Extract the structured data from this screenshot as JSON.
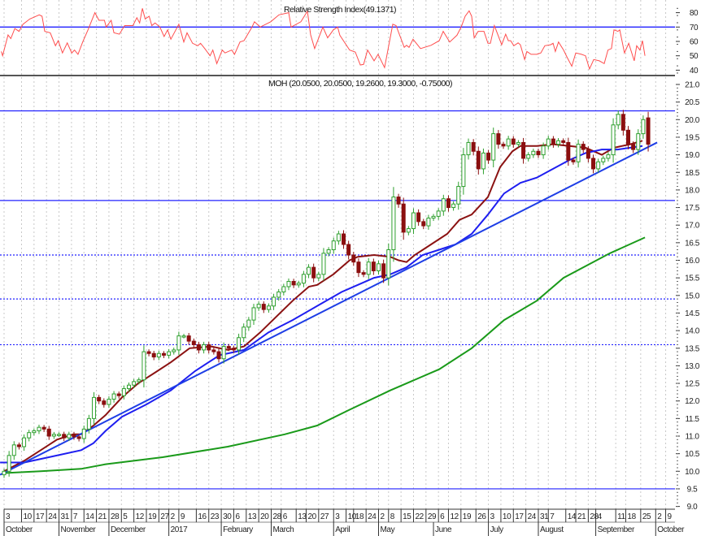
{
  "rsi_panel": {
    "title": "Relative Strength Index(49.1371)",
    "y_ticks": [
      80,
      70,
      60,
      50,
      40
    ],
    "ylim": [
      36,
      90
    ],
    "level": 70
  },
  "price_panel": {
    "title": "MOH (20.0500, 20.0500, 19.2600, 19.3000, -0.75000)",
    "y_ticks": [
      "21.0",
      "20.5",
      "20.0",
      "19.5",
      "19.0",
      "18.5",
      "18.0",
      "17.5",
      "17.0",
      "16.5",
      "16.0",
      "15.5",
      "15.0",
      "14.5",
      "14.0",
      "13.5",
      "13.0",
      "12.5",
      "12.0",
      "11.5",
      "11.0",
      "10.5",
      "10.0",
      "9.5",
      "9.0"
    ],
    "ylim": [
      9.0,
      21.0
    ]
  },
  "colors": {
    "up_candle": "#2ea02e",
    "down_candle": "#8b0f0f",
    "ma_short": "#8b1212",
    "ma_mid": "#1e1ef0",
    "ma_long": "#1a9a1a",
    "trendline": "#1e3ee6",
    "levels": "#2020ff",
    "rsi": "#ff4d4d",
    "grid": "#c8c8c8"
  },
  "chart_data": {
    "type": "candlestick",
    "x_unit": "trading day index (0 = 3 Oct 2016)",
    "bar_step_days": 2,
    "first_open": 9.9,
    "last_open": 20.05,
    "close": [
      10.0,
      10.45,
      10.75,
      10.7,
      10.95,
      11.1,
      11.15,
      11.25,
      11.2,
      11.0,
      11.05,
      11.05,
      10.95,
      11.05,
      10.98,
      10.93,
      11.2,
      11.5,
      12.1,
      12.0,
      11.9,
      12.05,
      12.2,
      12.15,
      12.35,
      12.45,
      12.55,
      12.6,
      13.4,
      13.35,
      13.25,
      13.35,
      13.3,
      13.4,
      13.45,
      13.85,
      13.85,
      13.7,
      13.6,
      13.45,
      13.6,
      13.45,
      13.4,
      13.2,
      13.55,
      13.5,
      13.45,
      13.8,
      14.1,
      14.3,
      14.65,
      14.75,
      14.6,
      14.7,
      14.95,
      15.1,
      15.25,
      15.4,
      15.3,
      15.35,
      15.6,
      15.8,
      15.5,
      15.6,
      16.2,
      16.3,
      16.55,
      16.75,
      16.45,
      16.15,
      15.95,
      15.65,
      15.6,
      15.95,
      15.7,
      15.9,
      15.5,
      16.3,
      17.8,
      17.6,
      16.8,
      16.9,
      17.35,
      17.1,
      16.98,
      17.2,
      17.25,
      17.4,
      17.75,
      17.5,
      17.6,
      18.1,
      19.0,
      19.35,
      19.1,
      18.6,
      19.05,
      18.85,
      19.6,
      19.3,
      19.25,
      19.45,
      19.3,
      19.35,
      18.9,
      19.0,
      19.1,
      19.0,
      19.25,
      19.45,
      19.3,
      19.4,
      19.35,
      18.85,
      18.8,
      19.3,
      19.15,
      18.9,
      18.6,
      18.8,
      18.9,
      19.0,
      19.85,
      20.15,
      19.7,
      19.3,
      19.15,
      19.6,
      20.0,
      19.3
    ],
    "moving_averages": [
      {
        "name": "short",
        "points": [
          [
            0,
            10.0
          ],
          [
            8.1,
            10.3
          ],
          [
            14.7,
            10.6
          ],
          [
            21.2,
            10.9
          ],
          [
            27.7,
            11.05
          ],
          [
            30.9,
            11.05
          ],
          [
            35.8,
            11.3
          ],
          [
            40.7,
            11.6
          ],
          [
            47.2,
            12.1
          ],
          [
            53.7,
            12.5
          ],
          [
            60.3,
            12.8
          ],
          [
            66.8,
            13.1
          ],
          [
            74.3,
            13.5
          ],
          [
            83.1,
            13.55
          ],
          [
            89.6,
            13.45
          ],
          [
            96.1,
            13.55
          ],
          [
            102.6,
            13.95
          ],
          [
            109.1,
            14.4
          ],
          [
            115.6,
            14.85
          ],
          [
            122.1,
            15.25
          ],
          [
            125.4,
            15.3
          ],
          [
            131.9,
            15.6
          ],
          [
            138.4,
            16.0
          ],
          [
            141.7,
            16.1
          ],
          [
            148.2,
            16.15
          ],
          [
            154.7,
            16.1
          ],
          [
            158,
            16.0
          ],
          [
            161.2,
            15.95
          ],
          [
            164.5,
            16.15
          ],
          [
            171,
            16.45
          ],
          [
            177.5,
            16.75
          ],
          [
            182.4,
            17.15
          ],
          [
            187.3,
            17.3
          ],
          [
            193.8,
            17.8
          ],
          [
            198.7,
            18.65
          ],
          [
            203.6,
            19.1
          ],
          [
            206.8,
            19.25
          ],
          [
            213.4,
            19.25
          ],
          [
            219.9,
            19.3
          ],
          [
            226.4,
            19.25
          ],
          [
            232.9,
            19.2
          ],
          [
            239.4,
            19.0
          ],
          [
            244.3,
            19.2
          ],
          [
            250.8,
            19.3
          ],
          [
            255.7,
            19.4
          ]
        ]
      },
      {
        "name": "mid",
        "points": [
          [
            -1.6,
            10.25
          ],
          [
            8.1,
            10.25
          ],
          [
            17.9,
            10.4
          ],
          [
            30.9,
            10.6
          ],
          [
            35.8,
            10.8
          ],
          [
            40.7,
            11.15
          ],
          [
            47.2,
            11.55
          ],
          [
            57,
            11.9
          ],
          [
            66.8,
            12.3
          ],
          [
            76.5,
            12.85
          ],
          [
            86.3,
            13.3
          ],
          [
            96.1,
            13.45
          ],
          [
            105.9,
            13.95
          ],
          [
            115.6,
            14.3
          ],
          [
            125.4,
            14.7
          ],
          [
            135.2,
            15.1
          ],
          [
            141.7,
            15.3
          ],
          [
            148.2,
            15.5
          ],
          [
            154.7,
            15.6
          ],
          [
            161.2,
            15.8
          ],
          [
            167.7,
            16.15
          ],
          [
            174.3,
            16.3
          ],
          [
            180.8,
            16.45
          ],
          [
            187.3,
            16.75
          ],
          [
            193.8,
            17.3
          ],
          [
            200.3,
            17.9
          ],
          [
            206.8,
            18.2
          ],
          [
            213.4,
            18.35
          ],
          [
            219.9,
            18.6
          ],
          [
            226.4,
            18.85
          ],
          [
            232.9,
            19.05
          ],
          [
            239.4,
            19.15
          ],
          [
            245.9,
            19.15
          ],
          [
            250.8,
            19.2
          ],
          [
            255.7,
            19.25
          ]
        ]
      },
      {
        "name": "long",
        "points": [
          [
            0,
            9.95
          ],
          [
            14.7,
            10.0
          ],
          [
            30.9,
            10.07
          ],
          [
            40.7,
            10.2
          ],
          [
            63.5,
            10.4
          ],
          [
            89.6,
            10.7
          ],
          [
            112.4,
            11.05
          ],
          [
            125.4,
            11.3
          ],
          [
            138.4,
            11.75
          ],
          [
            154.7,
            12.3
          ],
          [
            174.3,
            12.9
          ],
          [
            187.3,
            13.5
          ],
          [
            200.3,
            14.3
          ],
          [
            213.4,
            14.85
          ],
          [
            224.1,
            15.5
          ],
          [
            242.7,
            16.2
          ],
          [
            256.7,
            16.65
          ]
        ]
      }
    ],
    "trendline": [
      [
        -1.6,
        9.9
      ],
      [
        261.6,
        19.35
      ]
    ],
    "horizontal_levels": [
      {
        "value": 20.25,
        "style": "solid"
      },
      {
        "value": 17.7,
        "style": "solid"
      },
      {
        "value": 16.15,
        "style": "dotted"
      },
      {
        "value": 14.9,
        "style": "dotted"
      },
      {
        "value": 13.6,
        "style": "dotted"
      },
      {
        "value": 9.5,
        "style": "solid"
      }
    ],
    "rsi": [
      [
        -1.1,
        53
      ],
      [
        -0.6,
        50
      ],
      [
        1.6,
        64.5
      ],
      [
        2.7,
        62
      ],
      [
        4.3,
        69
      ],
      [
        6,
        67
      ],
      [
        7.6,
        72
      ],
      [
        10.3,
        75.6
      ],
      [
        14.1,
        78.5
      ],
      [
        15.2,
        77.5
      ],
      [
        16.3,
        67
      ],
      [
        18.5,
        66
      ],
      [
        20.6,
        57
      ],
      [
        21.7,
        60.5
      ],
      [
        23.4,
        52
      ],
      [
        25.3,
        59
      ],
      [
        27.1,
        52
      ],
      [
        28.2,
        54
      ],
      [
        29.6,
        51
      ],
      [
        31.5,
        59.6
      ],
      [
        33.6,
        68
      ],
      [
        36.4,
        80
      ],
      [
        38,
        74.7
      ],
      [
        40.2,
        74.7
      ],
      [
        40.9,
        70
      ],
      [
        42.9,
        74.7
      ],
      [
        44,
        66
      ],
      [
        46.2,
        65
      ],
      [
        48.3,
        71
      ],
      [
        51.6,
        71
      ],
      [
        53.2,
        76.5
      ],
      [
        54.3,
        72.8
      ],
      [
        55.4,
        83
      ],
      [
        56.5,
        75.6
      ],
      [
        58.1,
        77.5
      ],
      [
        59.2,
        71
      ],
      [
        60.5,
        72.8
      ],
      [
        62.4,
        70
      ],
      [
        64.1,
        63.4
      ],
      [
        65.5,
        68
      ],
      [
        66.8,
        61.5
      ],
      [
        70,
        72
      ],
      [
        72,
        59.6
      ],
      [
        73.3,
        66
      ],
      [
        75.5,
        58.7
      ],
      [
        77.6,
        57
      ],
      [
        78.7,
        58.7
      ],
      [
        80.4,
        55
      ],
      [
        82.5,
        50
      ],
      [
        83.6,
        54
      ],
      [
        85.2,
        44.6
      ],
      [
        87.4,
        54
      ],
      [
        88.5,
        52
      ],
      [
        91.2,
        54
      ],
      [
        92.3,
        51
      ],
      [
        94.5,
        59.6
      ],
      [
        96.1,
        60.5
      ],
      [
        99.3,
        70
      ],
      [
        100.3,
        73.7
      ],
      [
        102.6,
        70
      ],
      [
        106.8,
        73.7
      ],
      [
        110.1,
        78.5
      ],
      [
        114,
        80
      ],
      [
        115,
        70
      ],
      [
        118.9,
        73.7
      ],
      [
        121.5,
        81
      ],
      [
        122.8,
        64.5
      ],
      [
        124.4,
        55
      ],
      [
        127.7,
        70
      ],
      [
        129.6,
        62.5
      ],
      [
        131.9,
        68
      ],
      [
        133.6,
        70
      ],
      [
        134.5,
        64.3
      ],
      [
        138.4,
        54
      ],
      [
        140.7,
        52.6
      ],
      [
        142.7,
        43.6
      ],
      [
        144,
        44
      ],
      [
        145.6,
        54
      ],
      [
        148.2,
        46.5
      ],
      [
        149.8,
        51
      ],
      [
        152.4,
        41.8
      ],
      [
        155.7,
        72
      ],
      [
        157,
        71
      ],
      [
        160.3,
        55.9
      ],
      [
        161.2,
        57.3
      ],
      [
        162.2,
        55.9
      ],
      [
        163.8,
        61.5
      ],
      [
        166.8,
        55
      ],
      [
        171,
        57.3
      ],
      [
        174.3,
        60.5
      ],
      [
        175.9,
        67
      ],
      [
        178.5,
        59.6
      ],
      [
        181.4,
        64.3
      ],
      [
        183.1,
        70
      ],
      [
        184.7,
        77.5
      ],
      [
        186.3,
        81.3
      ],
      [
        187.3,
        77.5
      ],
      [
        188.3,
        62.5
      ],
      [
        189.9,
        67
      ],
      [
        192.2,
        67
      ],
      [
        193.8,
        58.7
      ],
      [
        194.8,
        58.7
      ],
      [
        196.4,
        71
      ],
      [
        199.3,
        57.7
      ],
      [
        200.9,
        65
      ],
      [
        202,
        60.5
      ],
      [
        202.9,
        60.5
      ],
      [
        204.2,
        57
      ],
      [
        205.9,
        59
      ],
      [
        206.8,
        57.7
      ],
      [
        208.5,
        47.4
      ],
      [
        209.4,
        53
      ],
      [
        211.1,
        51
      ],
      [
        213.4,
        51
      ],
      [
        215,
        52
      ],
      [
        216.6,
        57
      ],
      [
        218.9,
        57.7
      ],
      [
        219.9,
        58.7
      ],
      [
        220.8,
        53
      ],
      [
        222.1,
        59.6
      ],
      [
        224.1,
        54
      ],
      [
        225.4,
        49.3
      ],
      [
        227.4,
        42.7
      ],
      [
        229,
        52
      ],
      [
        231.3,
        51
      ],
      [
        232.9,
        50
      ],
      [
        234.5,
        40.8
      ],
      [
        236.2,
        47.4
      ],
      [
        238.4,
        46.5
      ],
      [
        240.4,
        44.6
      ],
      [
        241.9,
        54
      ],
      [
        243.3,
        55
      ],
      [
        244.3,
        68
      ],
      [
        245.9,
        67
      ],
      [
        246.6,
        68
      ],
      [
        248.5,
        52
      ],
      [
        250.2,
        58.7
      ],
      [
        252.4,
        46.5
      ],
      [
        253.4,
        57
      ],
      [
        254.7,
        54
      ],
      [
        255.7,
        60.5
      ],
      [
        256.7,
        50
      ]
    ],
    "x_ticks": [
      {
        "d": 0,
        "label": "3"
      },
      {
        "d": 7,
        "label": "10"
      },
      {
        "d": 12,
        "label": "17"
      },
      {
        "d": 17,
        "label": "24"
      },
      {
        "d": 22,
        "label": "31"
      },
      {
        "d": 27,
        "label": "7"
      },
      {
        "d": 32,
        "label": "14"
      },
      {
        "d": 37,
        "label": "21"
      },
      {
        "d": 42,
        "label": "28"
      },
      {
        "d": 47,
        "label": "5"
      },
      {
        "d": 52,
        "label": "12"
      },
      {
        "d": 57,
        "label": "19"
      },
      {
        "d": 62,
        "label": "27"
      },
      {
        "d": 66,
        "label": "2"
      },
      {
        "d": 70,
        "label": "9"
      },
      {
        "d": 77,
        "label": "16"
      },
      {
        "d": 82,
        "label": "23"
      },
      {
        "d": 87,
        "label": "30"
      },
      {
        "d": 92,
        "label": "6"
      },
      {
        "d": 97,
        "label": "13"
      },
      {
        "d": 102,
        "label": "20"
      },
      {
        "d": 107,
        "label": "28"
      },
      {
        "d": 111,
        "label": "6"
      },
      {
        "d": 117,
        "label": "13"
      },
      {
        "d": 121,
        "label": "20"
      },
      {
        "d": 126,
        "label": "27"
      },
      {
        "d": 132,
        "label": "3"
      },
      {
        "d": 137,
        "label": "10"
      },
      {
        "d": 140,
        "label": "18"
      },
      {
        "d": 145,
        "label": "24"
      },
      {
        "d": 150,
        "label": "2"
      },
      {
        "d": 154,
        "label": "8"
      },
      {
        "d": 159,
        "label": "15"
      },
      {
        "d": 164,
        "label": "22"
      },
      {
        "d": 169,
        "label": "29"
      },
      {
        "d": 174,
        "label": "6"
      },
      {
        "d": 178,
        "label": "12"
      },
      {
        "d": 183,
        "label": "19"
      },
      {
        "d": 189,
        "label": "26"
      },
      {
        "d": 194,
        "label": "3"
      },
      {
        "d": 199,
        "label": "10"
      },
      {
        "d": 204,
        "label": "17"
      },
      {
        "d": 209,
        "label": "24"
      },
      {
        "d": 214,
        "label": "31"
      },
      {
        "d": 218,
        "label": "7"
      },
      {
        "d": 225,
        "label": "14"
      },
      {
        "d": 229,
        "label": "21"
      },
      {
        "d": 234,
        "label": "28"
      },
      {
        "d": 237,
        "label": "4"
      },
      {
        "d": 245,
        "label": "11"
      },
      {
        "d": 249,
        "label": "18"
      },
      {
        "d": 255,
        "label": "25"
      },
      {
        "d": 261,
        "label": "2"
      },
      {
        "d": 265,
        "label": "9"
      }
    ],
    "months": [
      {
        "d": 0,
        "label": "October"
      },
      {
        "d": 22,
        "label": "November"
      },
      {
        "d": 42,
        "label": "December"
      },
      {
        "d": 66,
        "label": "2017"
      },
      {
        "d": 87,
        "label": "February"
      },
      {
        "d": 107,
        "label": "March"
      },
      {
        "d": 132,
        "label": "April"
      },
      {
        "d": 150,
        "label": "May"
      },
      {
        "d": 172,
        "label": "June"
      },
      {
        "d": 194,
        "label": "July"
      },
      {
        "d": 214,
        "label": "August"
      },
      {
        "d": 237,
        "label": "September"
      },
      {
        "d": 261,
        "label": "October"
      }
    ]
  }
}
